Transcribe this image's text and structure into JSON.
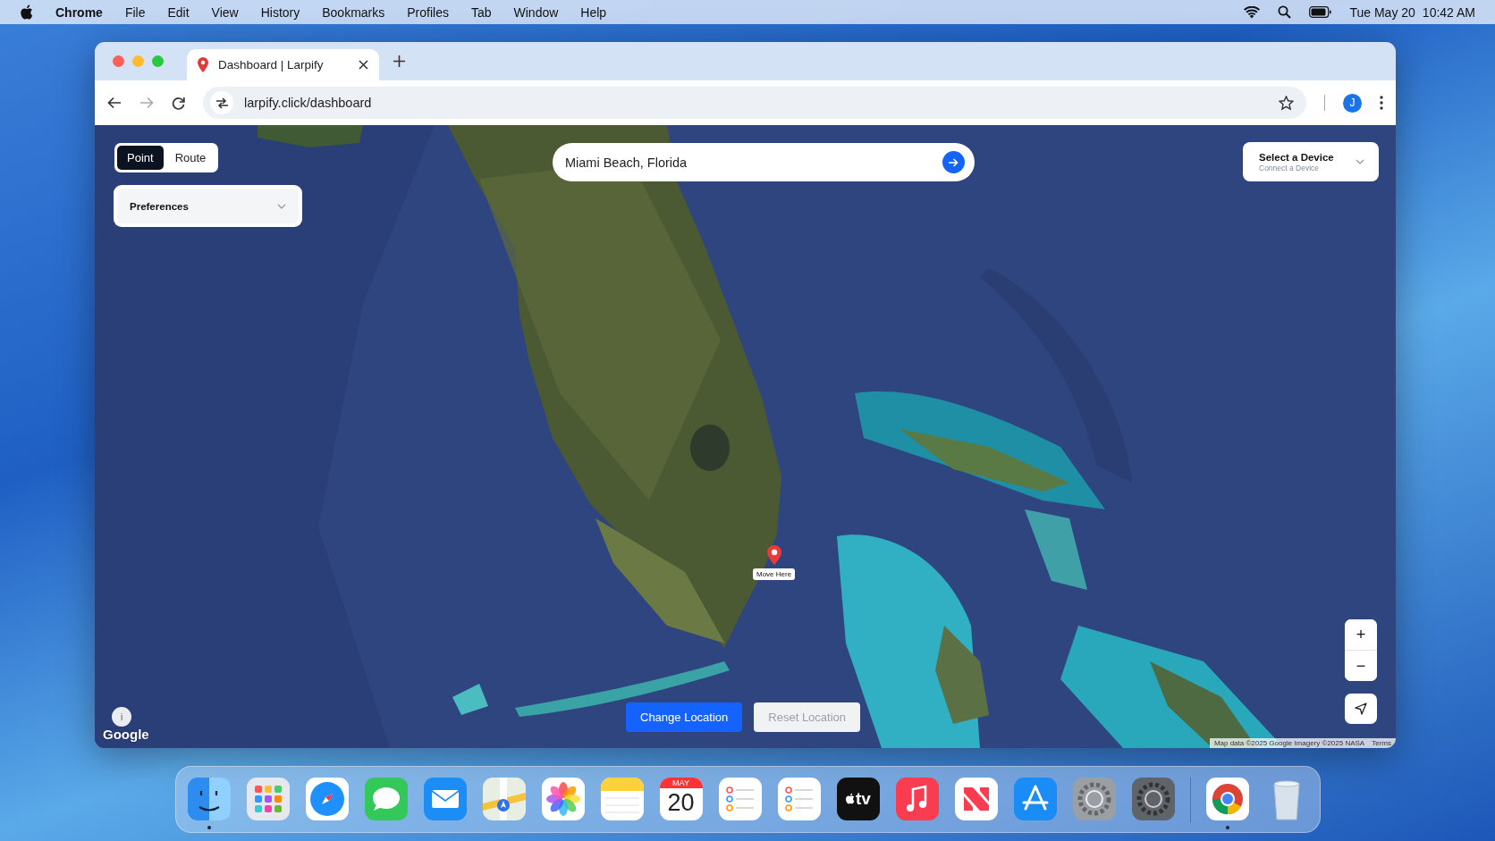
{
  "menu_bar": {
    "app": "Chrome",
    "menus": [
      "File",
      "Edit",
      "View",
      "History",
      "Bookmarks",
      "Profiles",
      "Tab",
      "Window",
      "Help"
    ],
    "date": "Tue May 20",
    "time": "10:42 AM"
  },
  "browser": {
    "tabs": [
      {
        "title": "Dashboard | Larpify",
        "selected": true
      }
    ],
    "address": "larpify.click/dashboard",
    "profile_initial": "J",
    "forward_disabled": true
  },
  "map": {
    "mode_toggle": [
      {
        "label": "Point",
        "selected": true
      },
      {
        "label": "Route",
        "selected": false
      }
    ],
    "preferences": {
      "label": "Preferences",
      "expanded": false
    },
    "search": {
      "value": "Miami Beach, Florida"
    },
    "device_select": {
      "title": "Select a Device",
      "subtitle": "Connect a Device"
    },
    "marker": {
      "label": "Move Here"
    },
    "zoom_in": "+",
    "zoom_out": "−",
    "buttons": [
      {
        "label": "Change Location",
        "kind": "primary",
        "disabled": false
      },
      {
        "label": "Reset Location",
        "kind": "secondary",
        "disabled": true
      }
    ],
    "info": "i",
    "logo": "Google",
    "attribution": "Map data ©2025 Google Imagery ©2025 NASA",
    "terms": "Terms"
  },
  "dock": {
    "apps": [
      {
        "kind": "finder",
        "running": true
      },
      {
        "kind": "launchpad",
        "running": false
      },
      {
        "kind": "safari",
        "running": false
      },
      {
        "kind": "messages",
        "running": false
      },
      {
        "kind": "mail",
        "running": false
      },
      {
        "kind": "maps",
        "running": false
      },
      {
        "kind": "photos",
        "running": false
      },
      {
        "kind": "notes",
        "running": false
      },
      {
        "kind": "calendar",
        "month": "MAY",
        "day": "20",
        "running": false
      },
      {
        "kind": "reminders",
        "running": false
      },
      {
        "kind": "reminders",
        "running": false
      },
      {
        "kind": "tv",
        "label": "tv",
        "running": false
      },
      {
        "kind": "music",
        "running": false
      },
      {
        "kind": "news",
        "running": false
      },
      {
        "kind": "appstore",
        "running": false
      },
      {
        "kind": "settings",
        "running": false
      },
      {
        "kind": "settings_dark",
        "running": false
      }
    ],
    "others": [
      {
        "kind": "chrome",
        "running": true
      },
      {
        "kind": "trash",
        "running": false
      }
    ]
  }
}
